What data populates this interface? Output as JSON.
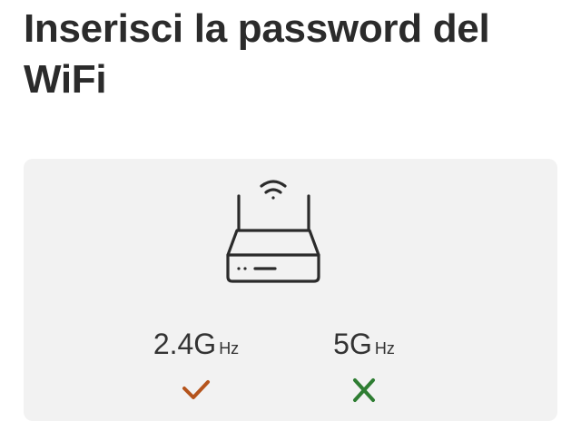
{
  "page": {
    "title": "Inserisci la password del WiFi"
  },
  "router_illustration": {
    "icon": "wifi-router-icon"
  },
  "bands": [
    {
      "value": "2.4G",
      "unit": "Hz",
      "status": "supported",
      "status_icon": "checkmark-icon",
      "color": "#b5541c"
    },
    {
      "value": "5G",
      "unit": "Hz",
      "status": "not supported",
      "status_icon": "cross-icon",
      "color": "#2e7d32"
    }
  ],
  "colors": {
    "text": "#2b2b2b",
    "card_background": "#f2f2f2",
    "check": "#b5541c",
    "cross": "#2e7d32"
  }
}
